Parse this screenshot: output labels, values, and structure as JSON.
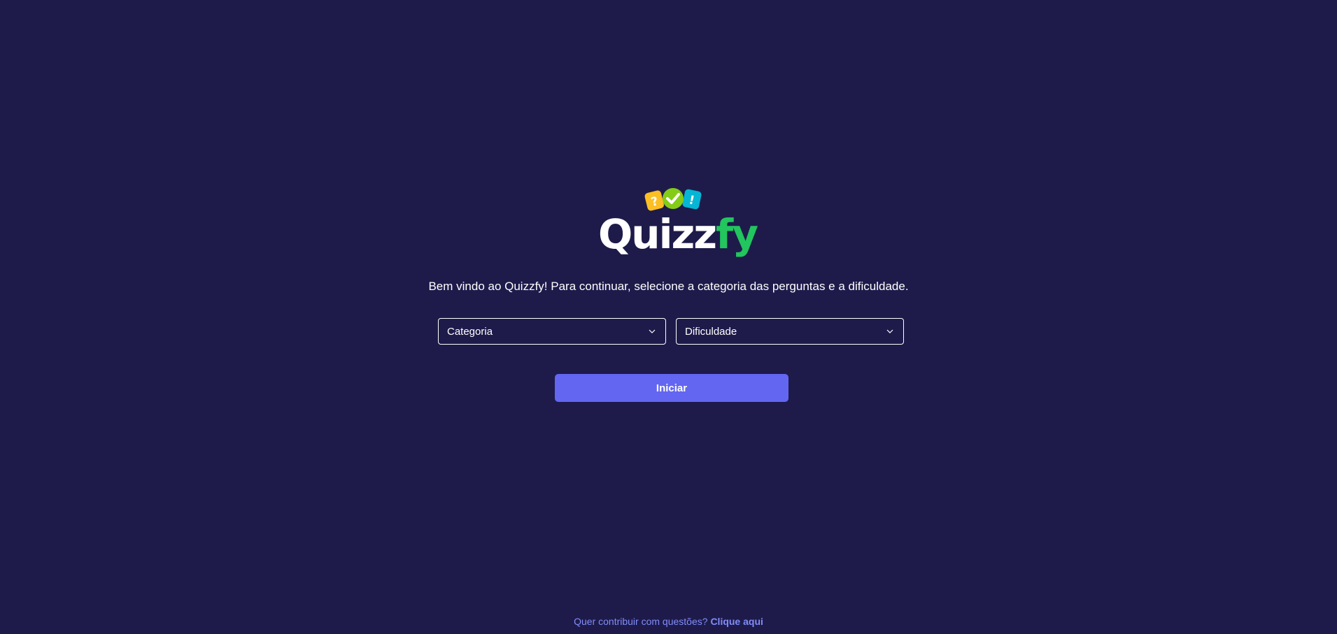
{
  "logo": {
    "text_main": "Quizz",
    "text_accent": "fy",
    "accent_color": "#22c55e",
    "icons": [
      "question-mark-icon",
      "check-icon",
      "exclamation-icon"
    ]
  },
  "welcome_text": "Bem vindo ao Quizzfy! Para continuar, selecione a categoria das perguntas e a dificuldade.",
  "category_select": {
    "label": "Categoria"
  },
  "difficulty_select": {
    "label": "Dificuldade"
  },
  "start_button": {
    "label": "Iniciar"
  },
  "footer": {
    "text": "Quer contribuir com questões?",
    "link": "Clique aqui"
  },
  "colors": {
    "background": "#1e1b4b",
    "primary": "#6366f1",
    "link": "#818cf8"
  }
}
